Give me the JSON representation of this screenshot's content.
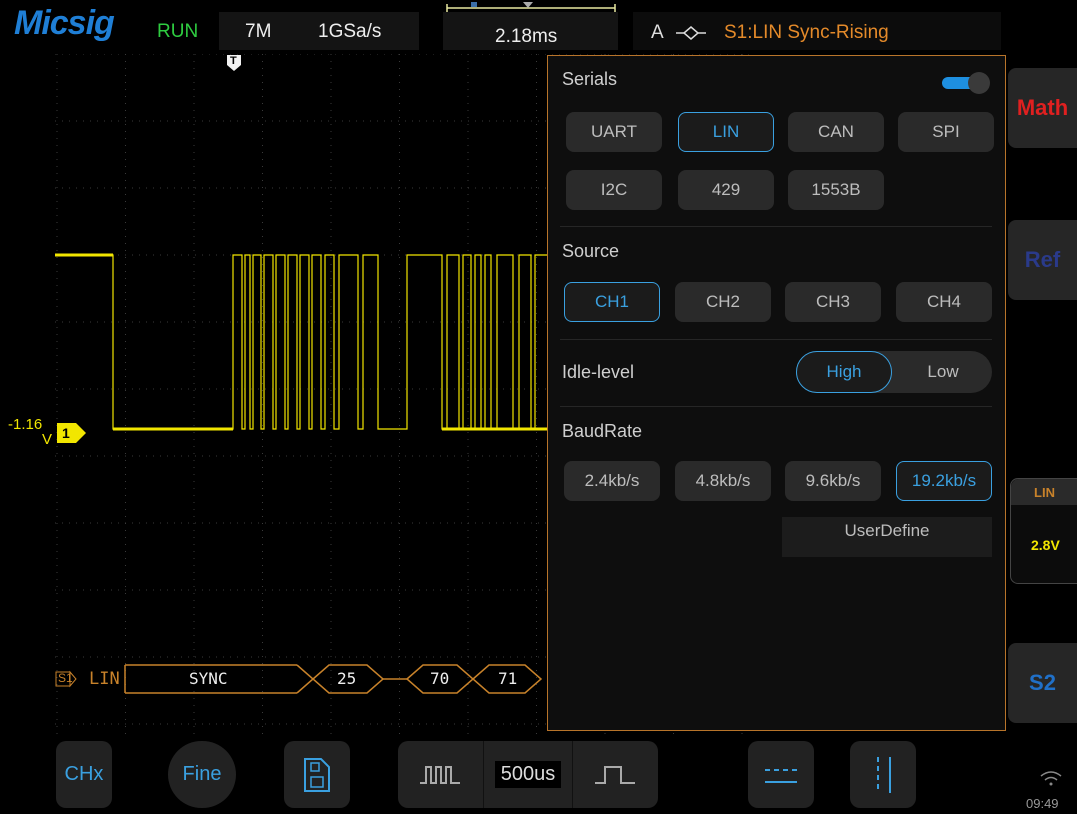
{
  "topbar": {
    "logo": "Micsig",
    "run_state": "RUN",
    "memory_depth": "7M",
    "sample_rate": "1GSa/s",
    "timebase_position": "2.18ms",
    "trigger_channel": "A",
    "trigger_desc": "S1:LIN Sync-Rising"
  },
  "waveform": {
    "trigger_marker": "T",
    "ch1_level_value": "-1.16",
    "ch1_level_unit": "V",
    "ch1_marker": "1",
    "decode_label": "S1",
    "decode_protocol": "LIN",
    "decode_fields": [
      "SYNC",
      "25",
      "70",
      "71"
    ],
    "color_trace": "#f2e600",
    "color_decode": "#c8822a"
  },
  "panel": {
    "serials_title": "Serials",
    "serials_enabled": true,
    "protocols": [
      "UART",
      "LIN",
      "CAN",
      "SPI",
      "I2C",
      "429",
      "1553B"
    ],
    "selected_protocol": "LIN",
    "source_title": "Source",
    "sources": [
      "CH1",
      "CH2",
      "CH3",
      "CH4"
    ],
    "selected_source": "CH1",
    "idle_title": "Idle-level",
    "idle_options": [
      "High",
      "Low"
    ],
    "selected_idle": "High",
    "baud_title": "BaudRate",
    "baud_rates": [
      "2.4kb/s",
      "4.8kb/s",
      "9.6kb/s",
      "19.2kb/s"
    ],
    "selected_baud": "19.2kb/s",
    "user_define": "UserDefine",
    "accent": "#3aa0e0",
    "border": "#b8742a"
  },
  "right": {
    "math": "Math",
    "ref": "Ref",
    "lin_label": "LIN",
    "lin_threshold": "2.8V",
    "s2": "S2"
  },
  "bottom": {
    "chx": "CHx",
    "fine": "Fine",
    "timebase": "500us",
    "clock": "09:49"
  }
}
